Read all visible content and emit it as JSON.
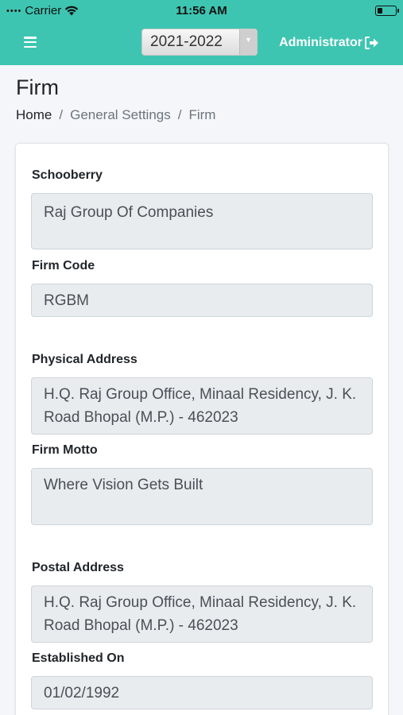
{
  "status_bar": {
    "carrier": "Carrier",
    "time": "11:56 AM"
  },
  "header": {
    "year": "2021-2022",
    "user": "Administrator",
    "colors": {
      "primary": "#3dc5b1"
    }
  },
  "page": {
    "title": "Firm",
    "breadcrumb": [
      "Home",
      "/",
      "General Settings",
      "/",
      "Firm"
    ]
  },
  "form": {
    "fields": [
      {
        "label": "Schooberry",
        "value": "Raj Group Of Companies"
      },
      {
        "label": "Firm Code",
        "value": "RGBM"
      },
      {
        "label": "Physical Address",
        "value": "H.Q. Raj Group Office, Minaal Residency, J. K. Road Bhopal (M.P.) - 462023"
      },
      {
        "label": "Firm Motto",
        "value": "Where Vision Gets Built"
      },
      {
        "label": "Postal Address",
        "value": "H.Q. Raj Group Office, Minaal Residency, J. K. Road Bhopal (M.P.) - 462023"
      },
      {
        "label": "Established On",
        "value": "01/02/1992"
      }
    ]
  }
}
